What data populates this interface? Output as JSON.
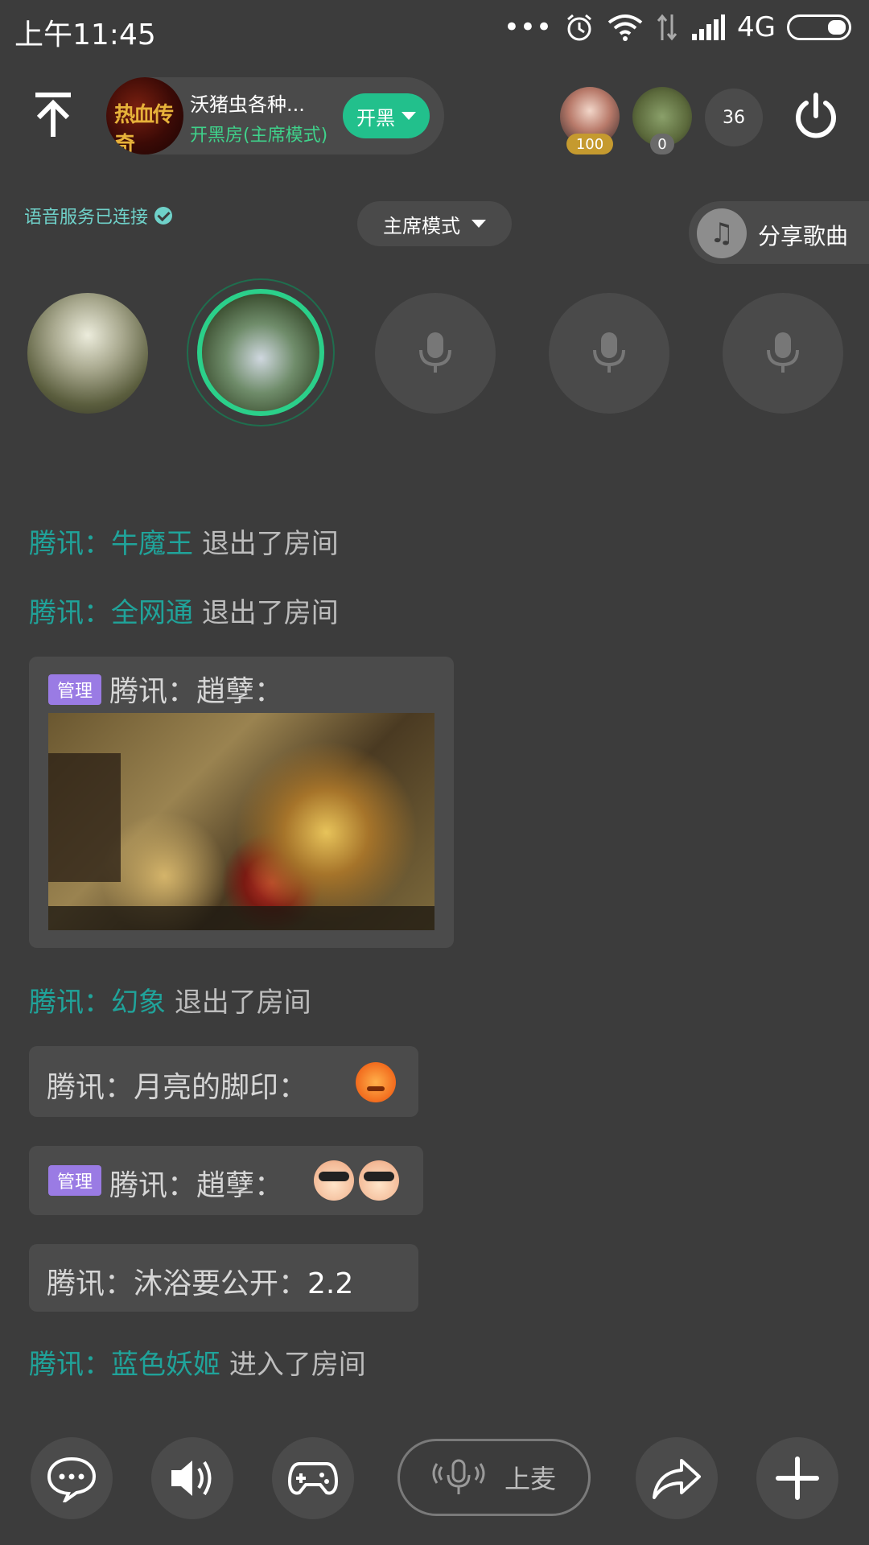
{
  "status_bar": {
    "time": "上午11:45",
    "network": "4G"
  },
  "room": {
    "title": "沃猪虫各种...",
    "subtitle": "开黑房(主席模式)",
    "kaihei_label": "开黑"
  },
  "top_users": {
    "user1_badge": "100",
    "user2_badge": "0",
    "online_count": "36"
  },
  "voice_status": "语音服务已连接",
  "mode_selector": "主席模式",
  "share_song": "分享歌曲",
  "chat": {
    "msg1": {
      "prefix": "腾讯：",
      "user": "牛魔王",
      "action": "退出了房间"
    },
    "msg2": {
      "prefix": "腾讯：",
      "user": "全网通",
      "action": "退出了房间"
    },
    "msg3": {
      "badge": "管理",
      "text": "腾讯：趙孽："
    },
    "msg4": {
      "prefix": "腾讯：",
      "user": "幻象",
      "action": "退出了房间"
    },
    "msg5": {
      "text": "腾讯：月亮的脚印："
    },
    "msg6": {
      "badge": "管理",
      "text": "腾讯：趙孽："
    },
    "msg7": {
      "prefix": "腾讯：沐浴要公开：",
      "value": "2.2"
    },
    "msg8": {
      "prefix": "腾讯：",
      "user": "蓝色妖姬",
      "action": "进入了房间"
    }
  },
  "toolbar": {
    "mic_label": "上麦"
  },
  "colors": {
    "background": "#3c3c3c",
    "accent_green": "#22c08c",
    "teal_text": "#20a39a",
    "admin_purple": "#9a7be4"
  }
}
